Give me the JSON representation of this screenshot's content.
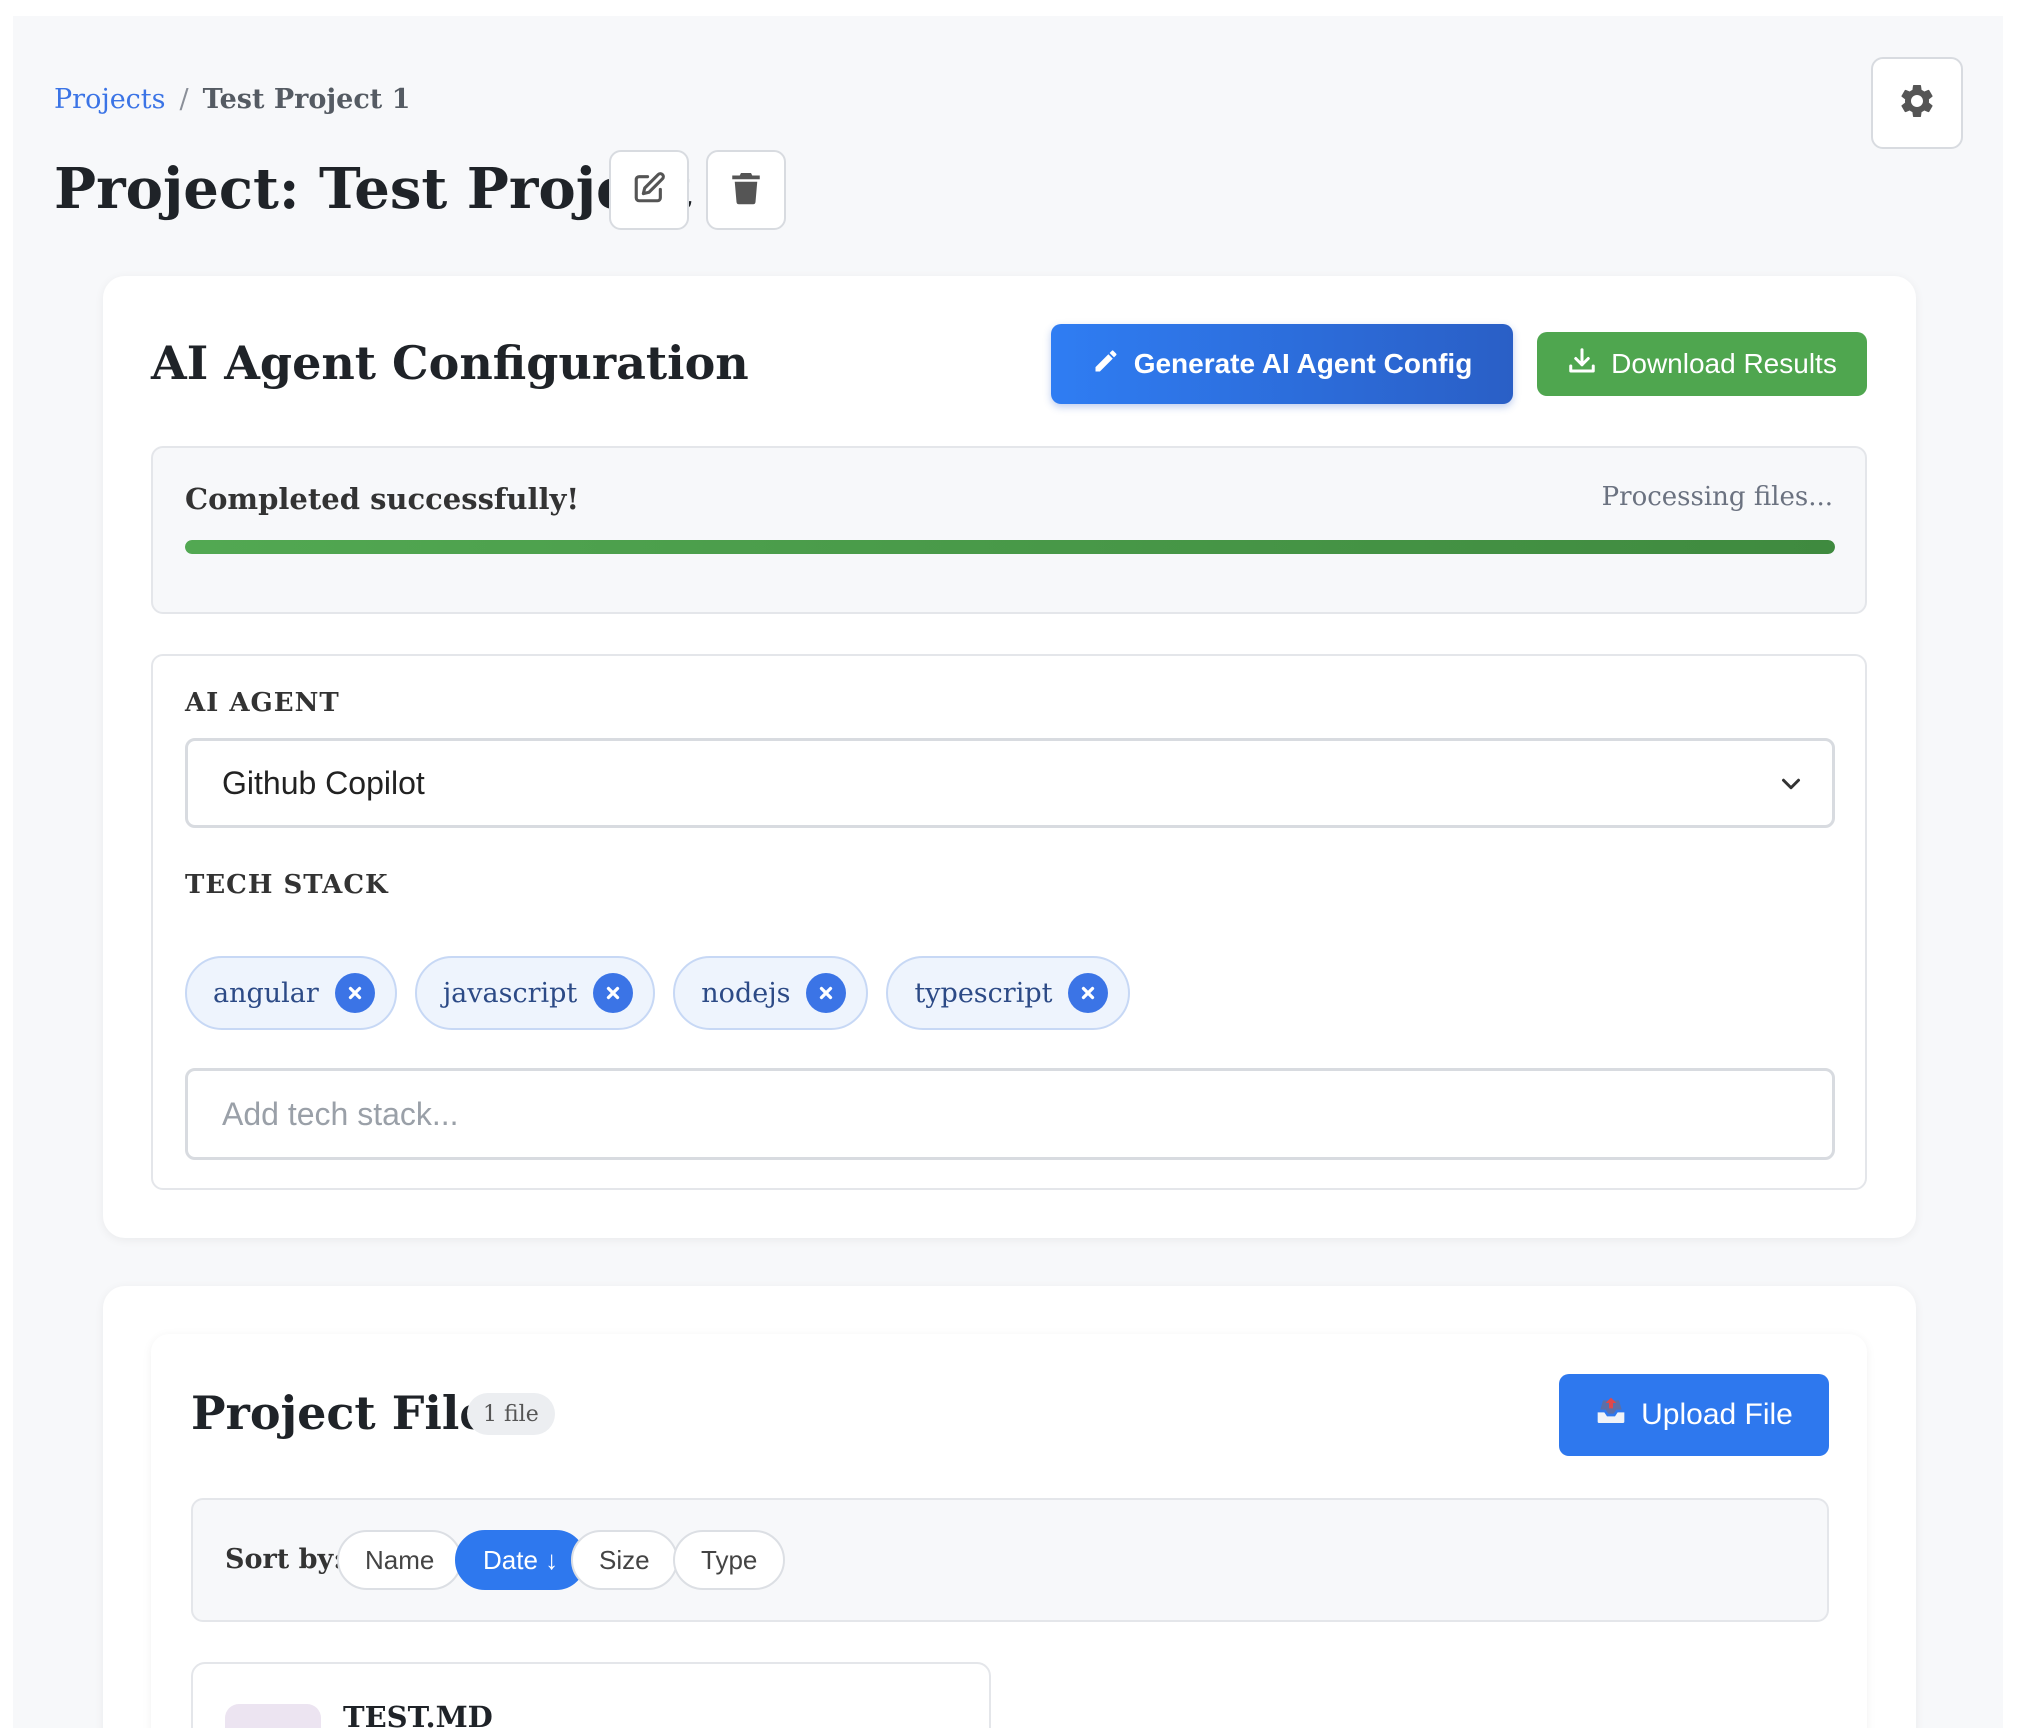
{
  "breadcrumb": {
    "root": "Projects",
    "separator": "/",
    "current": "Test Project 1"
  },
  "header": {
    "title": "Project: Test Project 1"
  },
  "config": {
    "title": "AI Agent Configuration",
    "generate_label": "Generate AI Agent Config",
    "download_label": "Download Results",
    "progress": {
      "status": "Completed successfully!",
      "note": "Processing files...",
      "percent": 100
    },
    "agent_label": "AI AGENT",
    "agent_value": "Github Copilot",
    "tech_label": "TECH STACK",
    "tags": [
      "angular",
      "javascript",
      "nodejs",
      "typescript"
    ],
    "tech_placeholder": "Add tech stack..."
  },
  "files": {
    "title": "Project Files",
    "count": "1 file",
    "upload_label": "Upload File",
    "sort_label": "Sort by:",
    "sort_options": [
      "Name",
      "Date ↓",
      "Size",
      "Type"
    ],
    "sort_active": "Date ↓",
    "items": [
      {
        "name": "TEST.MD"
      }
    ]
  },
  "colors": {
    "accent": "#2e78ee",
    "success": "#4fa64f",
    "tag_bg": "#eef4fd"
  }
}
